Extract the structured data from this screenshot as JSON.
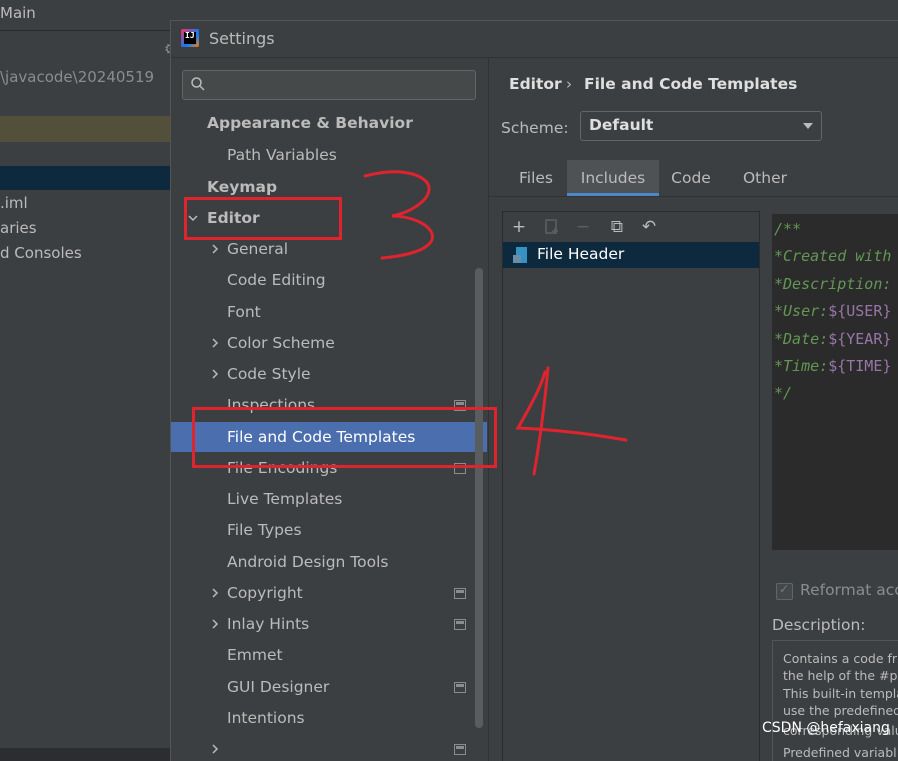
{
  "background": {
    "title": "Main",
    "path": "\\javacode\\20240519",
    "items": [
      ".iml",
      "aries",
      "d Consoles"
    ]
  },
  "dialog": {
    "title": "Settings",
    "app_icon_letters": "IJ",
    "search": {
      "placeholder": ""
    },
    "tree": [
      {
        "label": "Appearance & Behavior",
        "bold": true
      },
      {
        "label": "Path Variables"
      },
      {
        "label": "Keymap",
        "bold": true
      },
      {
        "label": "Editor",
        "bold": true
      },
      {
        "label": "General"
      },
      {
        "label": "Code Editing"
      },
      {
        "label": "Font"
      },
      {
        "label": "Color Scheme"
      },
      {
        "label": "Code Style"
      },
      {
        "label": "Inspections"
      },
      {
        "label": "File and Code Templates",
        "selected": true
      },
      {
        "label": "File Encodings"
      },
      {
        "label": "Live Templates"
      },
      {
        "label": "File Types"
      },
      {
        "label": "Android Design Tools"
      },
      {
        "label": "Copyright"
      },
      {
        "label": "Inlay Hints"
      },
      {
        "label": "Emmet"
      },
      {
        "label": "GUI Designer"
      },
      {
        "label": "Intentions"
      }
    ],
    "breadcrumb": {
      "parent": "Editor",
      "separator": "›",
      "current": "File and Code Templates"
    },
    "scheme": {
      "label": "Scheme:",
      "value": "Default"
    },
    "tabs": [
      {
        "label": "Files"
      },
      {
        "label": "Includes",
        "active": true
      },
      {
        "label": "Code"
      },
      {
        "label": "Other"
      }
    ],
    "toolbar": {
      "add": "+",
      "remove": "−",
      "copy": "⧉",
      "reset": "↶"
    },
    "templates": [
      {
        "name": "File Header"
      }
    ],
    "code": {
      "lines": [
        "/**",
        "*Created with",
        "*Description:",
        "*User:",
        "*Date:",
        "*Time:",
        "*/"
      ],
      "vars": [
        "${USER}",
        "${YEAR}",
        "${TIME}"
      ]
    },
    "reformat": {
      "label": "Reformat acco",
      "checked": true
    },
    "description": {
      "label": "Description:",
      "lines": [
        "Contains a code fr",
        "the help of the #p",
        "This built-in templa",
        "use the predefined",
        "corresponding valu",
        "Predefined variabl"
      ]
    }
  },
  "annotations": {
    "red_numbers": [
      "3",
      "4"
    ]
  },
  "watermark": "CSDN @hefaxiang",
  "colors": {
    "selection": "#4b6eaf",
    "annotation": "#e0242e",
    "comment": "#629755",
    "variable": "#9876aa"
  }
}
